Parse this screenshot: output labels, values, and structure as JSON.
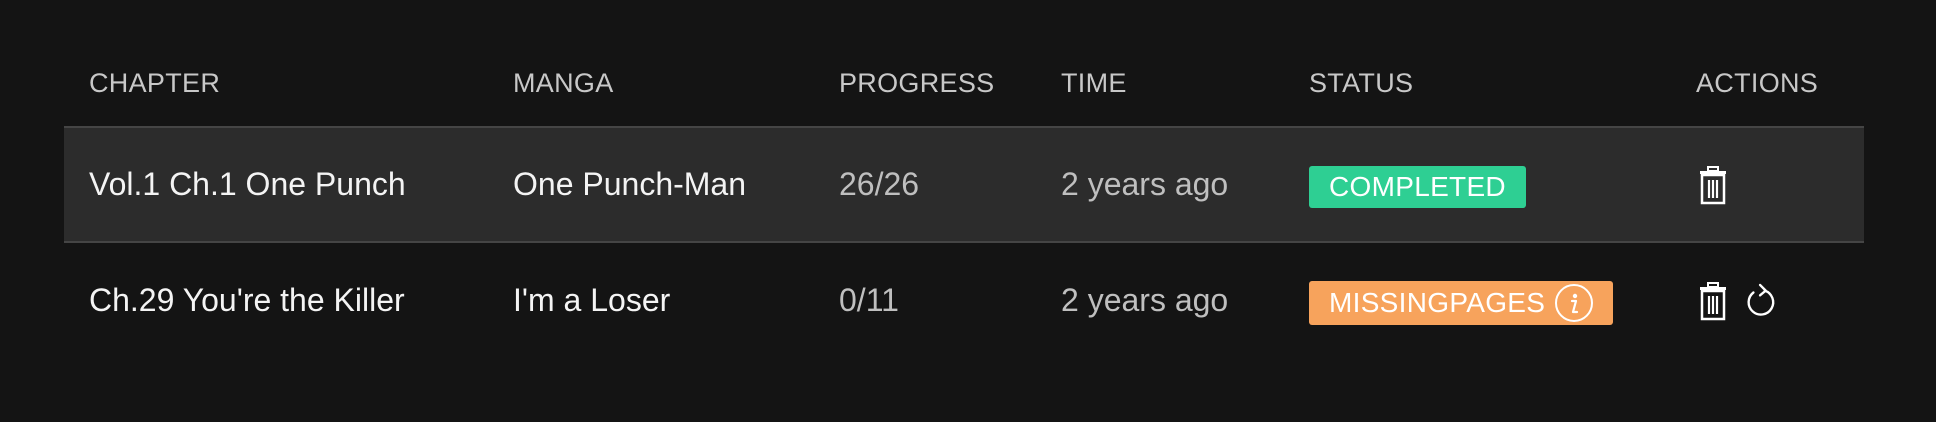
{
  "table": {
    "headers": {
      "chapter": "CHAPTER",
      "manga": "MANGA",
      "progress": "PROGRESS",
      "time": "TIME",
      "status": "STATUS",
      "actions": "ACTIONS"
    },
    "rows": [
      {
        "chapter": "Vol.1 Ch.1 One Punch",
        "manga": "One Punch-Man",
        "progress": "26/26",
        "time": "2 years ago",
        "status": "COMPLETED",
        "status_color": "#2ecf93",
        "actions": [
          "trash-icon"
        ]
      },
      {
        "chapter": "Ch.29 You're the Killer",
        "manga": "I'm a Loser",
        "progress": "0/11",
        "time": "2 years ago",
        "status": "MISSINGPAGES",
        "status_color": "#f7a35c",
        "status_icon": "info-icon",
        "actions": [
          "trash-icon",
          "retry-icon"
        ]
      }
    ]
  },
  "colors": {
    "background": "#141414",
    "row_highlight": "#2c2c2c",
    "divider": "#454545"
  }
}
